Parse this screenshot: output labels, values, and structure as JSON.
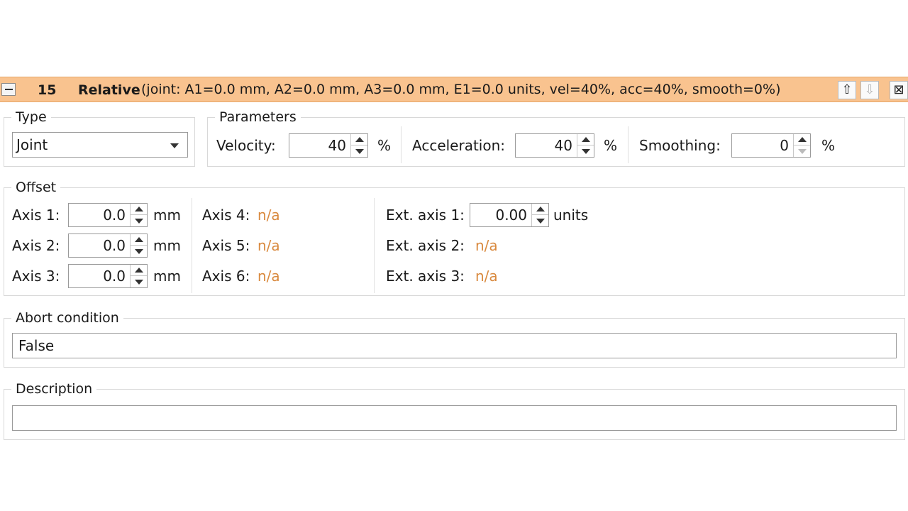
{
  "header": {
    "step_number": "15",
    "step_type": "Relative",
    "summary": "(joint: A1=0.0 mm, A2=0.0 mm, A3=0.0 mm, E1=0.0 units, vel=40%, acc=40%, smooth=0%)",
    "color": "#f9c38f",
    "buttons": {
      "up": "⇧",
      "down": "⇩",
      "close": "⊠"
    }
  },
  "type_group": {
    "label": "Type",
    "selected": "Joint"
  },
  "parameters": {
    "label": "Parameters",
    "velocity": {
      "label": "Velocity:",
      "value": "40",
      "unit": "%"
    },
    "acceleration": {
      "label": "Acceleration:",
      "value": "40",
      "unit": "%"
    },
    "smoothing": {
      "label": "Smoothing:",
      "value": "0",
      "unit": "%"
    }
  },
  "offset": {
    "label": "Offset",
    "axis1": {
      "label": "Axis 1:",
      "value": "0.0",
      "unit": "mm"
    },
    "axis2": {
      "label": "Axis 2:",
      "value": "0.0",
      "unit": "mm"
    },
    "axis3": {
      "label": "Axis 3:",
      "value": "0.0",
      "unit": "mm"
    },
    "axis4": {
      "label": "Axis 4:",
      "value": "n/a"
    },
    "axis5": {
      "label": "Axis 5:",
      "value": "n/a"
    },
    "axis6": {
      "label": "Axis 6:",
      "value": "n/a"
    },
    "ext1": {
      "label": "Ext. axis 1:",
      "value": "0.00",
      "unit": "units"
    },
    "ext2": {
      "label": "Ext. axis 2:",
      "value": "n/a"
    },
    "ext3": {
      "label": "Ext. axis 3:",
      "value": "n/a"
    },
    "na_color": "#d98a3f"
  },
  "abort": {
    "label": "Abort condition",
    "value": "False"
  },
  "description": {
    "label": "Description",
    "value": ""
  }
}
